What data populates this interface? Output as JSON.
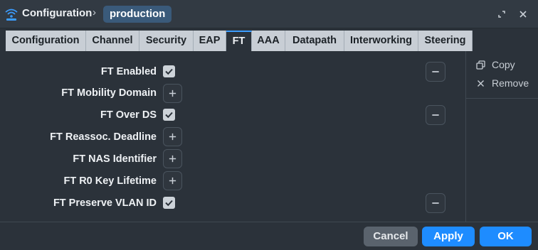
{
  "titlebar": {
    "title": "Configuration",
    "separator": "›",
    "pill": "production"
  },
  "tabs": [
    {
      "label": "Configuration",
      "active": false
    },
    {
      "label": "Channel",
      "active": false
    },
    {
      "label": "Security",
      "active": false
    },
    {
      "label": "EAP",
      "active": false
    },
    {
      "label": "FT",
      "active": true
    },
    {
      "label": "AAA",
      "active": false
    },
    {
      "label": "Datapath",
      "active": false
    },
    {
      "label": "Interworking",
      "active": false
    },
    {
      "label": "Steering",
      "active": false
    }
  ],
  "rows": [
    {
      "label": "FT Enabled",
      "control": "checkbox",
      "checked": true,
      "removable": true
    },
    {
      "label": "FT Mobility Domain",
      "control": "add"
    },
    {
      "label": "FT Over DS",
      "control": "checkbox",
      "checked": true,
      "removable": true
    },
    {
      "label": "FT Reassoc. Deadline",
      "control": "add"
    },
    {
      "label": "FT NAS Identifier",
      "control": "add"
    },
    {
      "label": "FT R0 Key Lifetime",
      "control": "add"
    },
    {
      "label": "FT Preserve VLAN ID",
      "control": "checkbox",
      "checked": true,
      "removable": true
    }
  ],
  "side": {
    "copy": "Copy",
    "remove": "Remove"
  },
  "footer": {
    "cancel": "Cancel",
    "apply": "Apply",
    "ok": "OK"
  },
  "colors": {
    "accent": "#1e8cff",
    "pill": "#3a5a7a",
    "background": "#2b323a"
  }
}
